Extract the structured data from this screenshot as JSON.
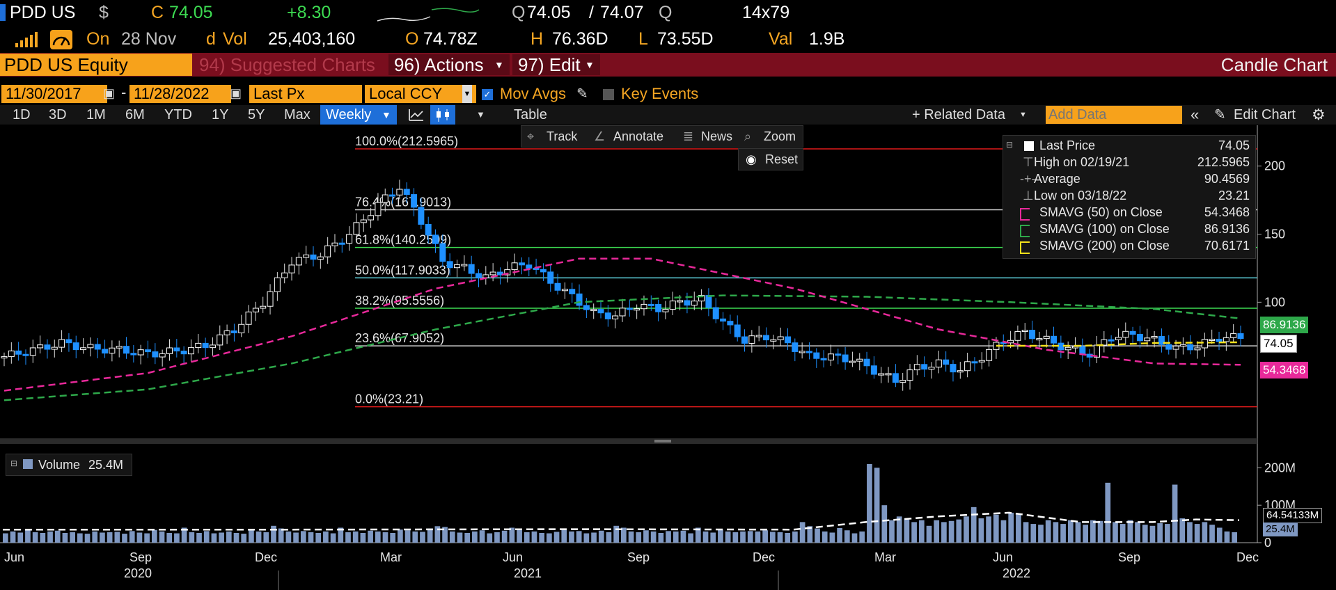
{
  "header": {
    "ticker": "PDD US",
    "currency_symbol": "$",
    "close_label": "C",
    "close_value": "74.05",
    "change": "+8.30",
    "bid_label": "Q",
    "bid": "74.05",
    "ask": "74.07",
    "ask_suffix": "Q",
    "size": "14x79",
    "on_label": "On",
    "date": "28 Nov",
    "d_label": "d",
    "vol_label": "Vol",
    "volume": "25,403,160",
    "open_label": "O",
    "open": "74.78Z",
    "high_label": "H",
    "high": "76.36D",
    "low_label": "L",
    "low": "73.55D",
    "val_label": "Val",
    "value": "1.9B"
  },
  "menu": {
    "security": "PDD US Equity",
    "suggested": "94) Suggested Charts",
    "actions": "96) Actions",
    "edit": "97) Edit",
    "chart_type": "Candle Chart"
  },
  "controls": {
    "start_date": "11/30/2017",
    "dash": "-",
    "end_date": "11/28/2022",
    "field": "Last Px",
    "ccy": "Local CCY",
    "mov_avgs": "Mov Avgs",
    "key_events": "Key Events"
  },
  "toolbar": {
    "periods": [
      "1D",
      "3D",
      "1M",
      "6M",
      "YTD",
      "1Y",
      "5Y",
      "Max"
    ],
    "frequency": "Weekly",
    "table": "Table",
    "related": "+ Related Data",
    "add_data_placeholder": "Add Data",
    "edit_chart": "Edit Chart"
  },
  "chart_tools": {
    "track": "Track",
    "annotate": "Annotate",
    "news": "News",
    "zoom": "Zoom",
    "reset": "Reset"
  },
  "legend": {
    "last_price": {
      "label": "Last Price",
      "value": "74.05"
    },
    "high": {
      "label": "High on 02/19/21",
      "value": "212.5965"
    },
    "average": {
      "label": "Average",
      "value": "90.4569"
    },
    "low": {
      "label": "Low on 03/18/22",
      "value": "23.21"
    },
    "sma50": {
      "label": "SMAVG (50)  on Close",
      "value": "54.3468"
    },
    "sma100": {
      "label": "SMAVG (100)  on Close",
      "value": "86.9136"
    },
    "sma200": {
      "label": "SMAVG (200)  on Close",
      "value": "70.6171"
    }
  },
  "volume_panel": {
    "label": "Volume",
    "value": "25.4M"
  },
  "colors": {
    "up": "#ffffff",
    "down": "#1e90ff",
    "sma50": "#e8299a",
    "sma100": "#2ea84a",
    "sma200": "#f5e11b",
    "volume": "#7f98c2",
    "accent": "#f7a21b"
  },
  "chart_data": [
    {
      "type": "candlestick",
      "ylim": [
        0,
        230
      ],
      "yticks": [
        {
          "v": 200,
          "label": "200"
        },
        {
          "v": 150,
          "label": "150"
        },
        {
          "v": 100,
          "label": "100"
        }
      ],
      "x_month_labels": [
        "Jun",
        "Sep",
        "Dec",
        "Mar",
        "Jun",
        "Sep",
        "Dec",
        "Mar",
        "Jun",
        "Sep",
        "Dec"
      ],
      "x_year_labels": [
        "2020",
        "2021",
        "2022"
      ],
      "close_points": [
        [
          0,
          60
        ],
        [
          4,
          65
        ],
        [
          8,
          70
        ],
        [
          12,
          66
        ],
        [
          16,
          65
        ],
        [
          20,
          62
        ],
        [
          24,
          64
        ],
        [
          28,
          68
        ],
        [
          32,
          80
        ],
        [
          36,
          100
        ],
        [
          40,
          130
        ],
        [
          44,
          135
        ],
        [
          48,
          150
        ],
        [
          52,
          172
        ],
        [
          55,
          185
        ],
        [
          58,
          160
        ],
        [
          61,
          130
        ],
        [
          64,
          125
        ],
        [
          67,
          118
        ],
        [
          70,
          125
        ],
        [
          73,
          128
        ],
        [
          76,
          115
        ],
        [
          79,
          104
        ],
        [
          82,
          92
        ],
        [
          85,
          90
        ],
        [
          88,
          98
        ],
        [
          91,
          95
        ],
        [
          94,
          100
        ],
        [
          97,
          102
        ],
        [
          100,
          85
        ],
        [
          103,
          72
        ],
        [
          106,
          75
        ],
        [
          109,
          70
        ],
        [
          112,
          60
        ],
        [
          115,
          60
        ],
        [
          118,
          58
        ],
        [
          121,
          50
        ],
        [
          124,
          42
        ],
        [
          127,
          52
        ],
        [
          130,
          55
        ],
        [
          133,
          50
        ],
        [
          136,
          60
        ],
        [
          139,
          72
        ],
        [
          142,
          78
        ],
        [
          145,
          72
        ],
        [
          148,
          66
        ],
        [
          151,
          62
        ],
        [
          154,
          75
        ],
        [
          157,
          76
        ],
        [
          160,
          72
        ],
        [
          163,
          66
        ],
        [
          166,
          68
        ],
        [
          169,
          74
        ],
        [
          172,
          74
        ]
      ],
      "high_low": {
        "high": 212.5965,
        "low": 23.21
      },
      "fib_levels": [
        {
          "pct": "100.0%",
          "value": 212.5965,
          "color": "#e11b1b"
        },
        {
          "pct": "76.4%",
          "value": 167.9013,
          "color": "#cfcfcf"
        },
        {
          "pct": "61.8%",
          "value": 140.2509,
          "color": "#3ddc52"
        },
        {
          "pct": "50.0%",
          "value": 117.9033,
          "color": "#5fd4e0"
        },
        {
          "pct": "38.2%",
          "value": 95.5556,
          "color": "#3ddc52"
        },
        {
          "pct": "23.6%",
          "value": 67.9052,
          "color": "#cfcfcf"
        },
        {
          "pct": "0.0%",
          "value": 23.21,
          "color": "#e11b1b"
        }
      ],
      "sma50": [
        [
          0,
          35
        ],
        [
          20,
          48
        ],
        [
          40,
          75
        ],
        [
          60,
          110
        ],
        [
          80,
          132
        ],
        [
          90,
          132
        ],
        [
          110,
          110
        ],
        [
          130,
          80
        ],
        [
          145,
          65
        ],
        [
          160,
          55
        ],
        [
          172,
          54
        ]
      ],
      "sma100": [
        [
          0,
          28
        ],
        [
          20,
          36
        ],
        [
          40,
          55
        ],
        [
          60,
          80
        ],
        [
          80,
          100
        ],
        [
          100,
          105
        ],
        [
          120,
          104
        ],
        [
          140,
          100
        ],
        [
          160,
          95
        ],
        [
          172,
          88
        ]
      ],
      "sma200": [
        [
          138,
          68
        ],
        [
          150,
          68
        ],
        [
          160,
          70
        ],
        [
          172,
          70.6
        ]
      ],
      "last_labels": [
        {
          "value": "86.9136",
          "color": "#2ea84a"
        },
        {
          "value": "74.05",
          "color": "#ffffff"
        },
        {
          "value": "54.3468",
          "color": "#e8299a"
        }
      ]
    },
    {
      "type": "bar",
      "title": "Volume",
      "ylim": [
        0,
        260
      ],
      "yticks": [
        {
          "v": 200,
          "label": "200M"
        },
        {
          "v": 100,
          "label": "100M"
        },
        {
          "v": 0,
          "label": "0"
        }
      ],
      "current_label": "25.4M",
      "avg_label": "64.54133M",
      "values": [
        25,
        30,
        27,
        35,
        28,
        26,
        30,
        32,
        26,
        28,
        25,
        24,
        30,
        27,
        28,
        29,
        24,
        31,
        27,
        25,
        34,
        30,
        26,
        25,
        40,
        28,
        26,
        31,
        25,
        27,
        30,
        26,
        24,
        33,
        30,
        28,
        45,
        38,
        30,
        27,
        31,
        28,
        26,
        30,
        25,
        40,
        28,
        30,
        26,
        32,
        30,
        28,
        26,
        35,
        33,
        30,
        29,
        38,
        44,
        42,
        30,
        27,
        26,
        30,
        33,
        25,
        28,
        32,
        40,
        35,
        28,
        30,
        26,
        25,
        29,
        34,
        30,
        31,
        25,
        27,
        32,
        28,
        45,
        40,
        30,
        28,
        33,
        30,
        26,
        31,
        30,
        32,
        25,
        40,
        30,
        27,
        35,
        30,
        28,
        30,
        31,
        30,
        33,
        29,
        28,
        26,
        30,
        55,
        44,
        38,
        30,
        27,
        39,
        33,
        25,
        30,
        210,
        200,
        100,
        60,
        70,
        65,
        55,
        60,
        45,
        60,
        55,
        58,
        62,
        70,
        95,
        65,
        70,
        75,
        60,
        80,
        78,
        55,
        50,
        48,
        60,
        55,
        50,
        60,
        55,
        48,
        60,
        58,
        160,
        55,
        50,
        60,
        55,
        48,
        45,
        52,
        50,
        155,
        65,
        55,
        50,
        55,
        48,
        40,
        30,
        28
      ],
      "avg_line": [
        [
          0,
          35
        ],
        [
          40,
          35
        ],
        [
          80,
          36
        ],
        [
          110,
          35
        ],
        [
          120,
          55
        ],
        [
          130,
          70
        ],
        [
          140,
          80
        ],
        [
          150,
          55
        ],
        [
          160,
          55
        ],
        [
          166,
          62
        ],
        [
          172,
          60
        ]
      ]
    }
  ]
}
